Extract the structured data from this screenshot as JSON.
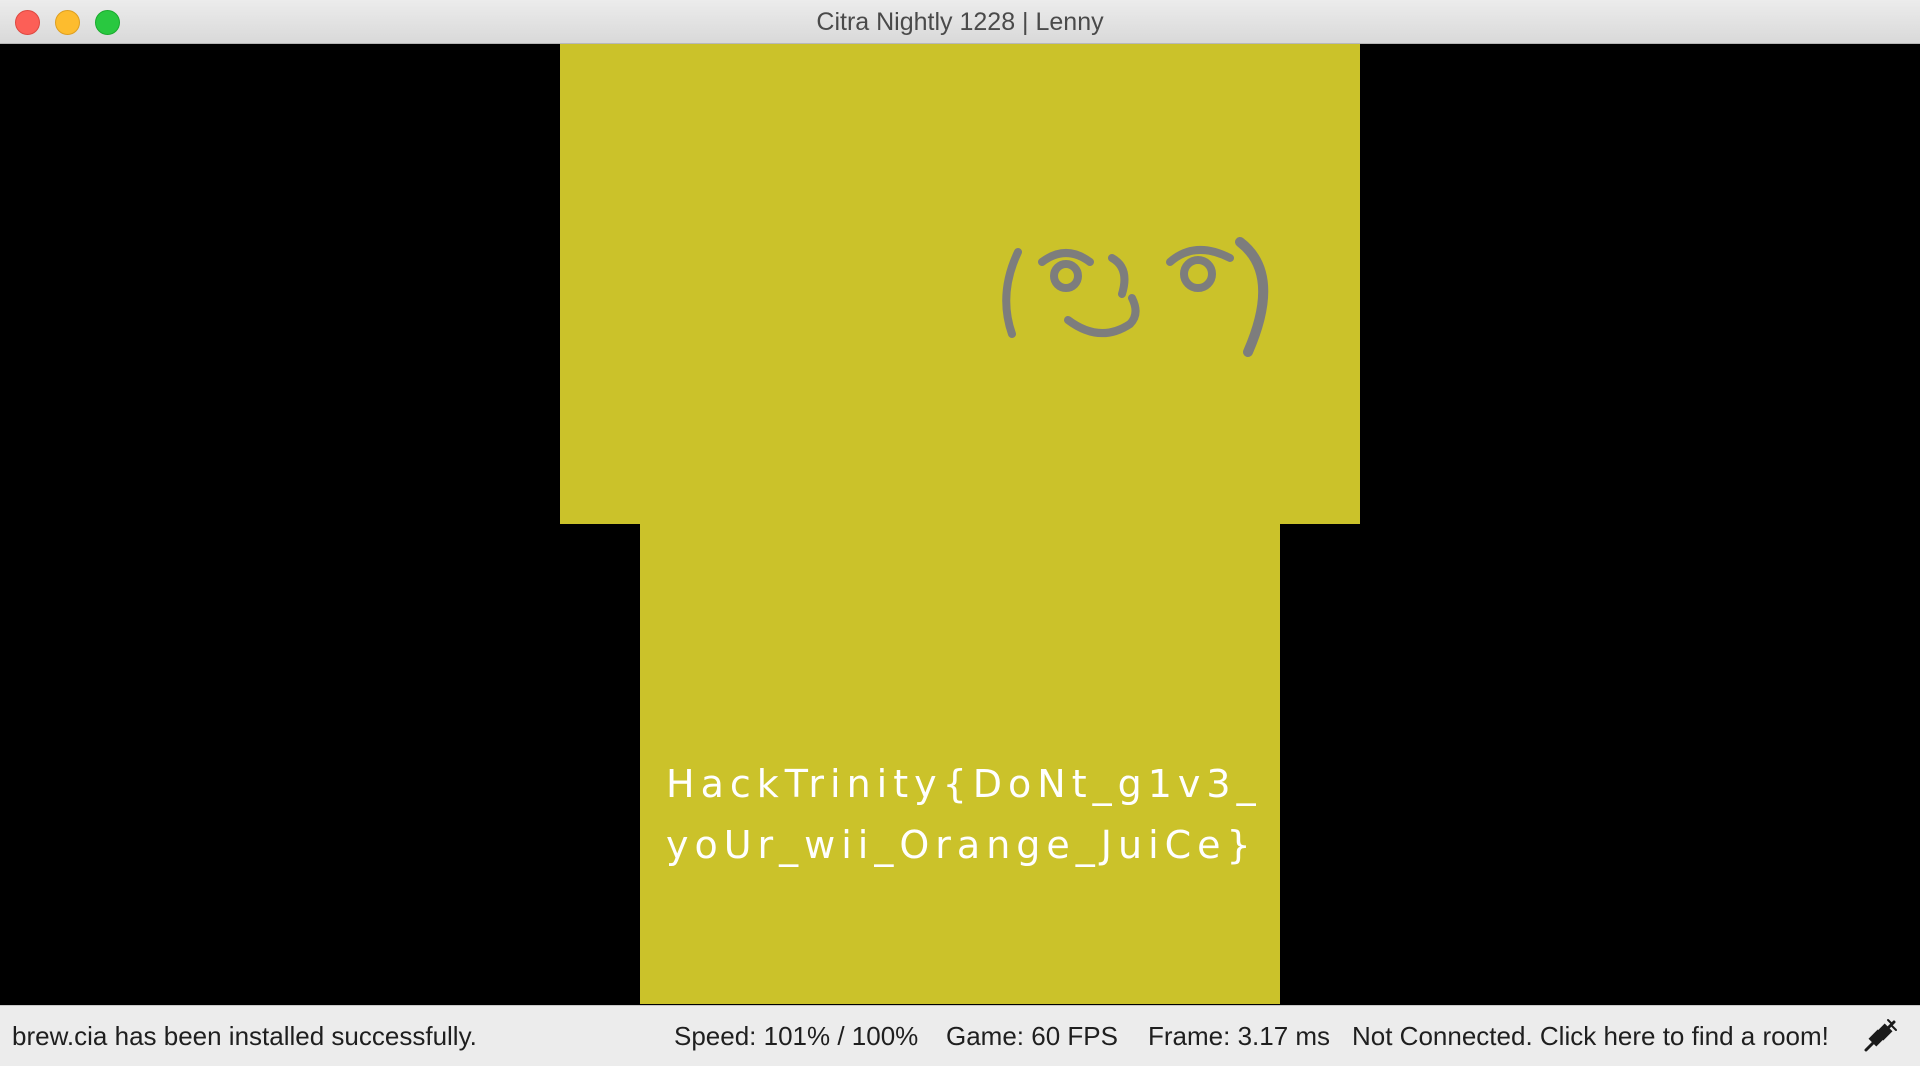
{
  "window": {
    "title": "Citra Nightly 1228 | Lenny"
  },
  "colors": {
    "screen_bg": "#cbc22a",
    "face": "#7d7d7d",
    "flag_text": "#ffffff"
  },
  "top_screen": {
    "face_icon": "lenny-face"
  },
  "bottom_screen": {
    "flag_line1": "HackTrinity{DoNt_g1v3_",
    "flag_line2": "yoUr_wii_Orange_JuiCe}"
  },
  "status": {
    "message": "brew.cia has been installed successfully.",
    "speed": "Speed: 101% / 100%",
    "fps": "Game: 60 FPS",
    "frame": "Frame: 3.17 ms",
    "network": "Not Connected. Click here to find a room!",
    "network_icon": "disconnected-plug-icon"
  }
}
